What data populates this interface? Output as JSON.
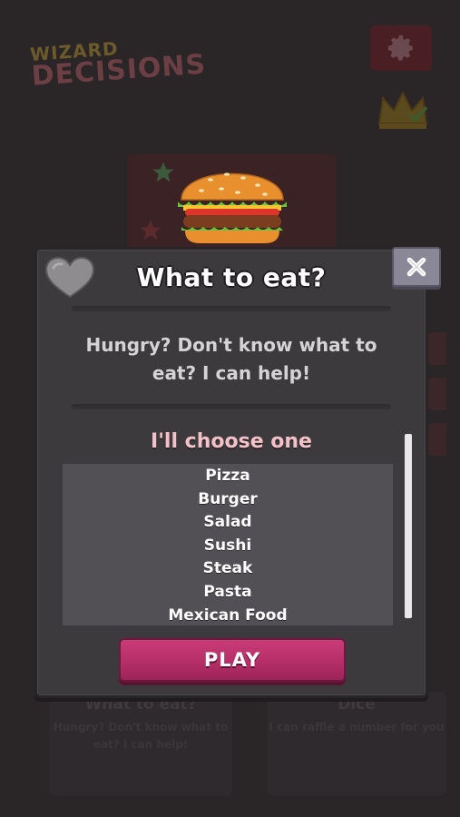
{
  "background": {
    "logo_line1": "WIZARD",
    "logo_line2": "DECISIONS",
    "card_left": {
      "title": "What to eat?",
      "description": "Hungry? Don't know what to eat? I can help!"
    },
    "card_right": {
      "title": "Dice",
      "description": "I can raffle a number for you"
    }
  },
  "icons": {
    "settings": "gear-icon",
    "crown": "crown-icon",
    "favorite": "heart-icon",
    "close": "close-icon",
    "burger": "burger-icon"
  },
  "dialog": {
    "title": "What to eat?",
    "subtitle": "Hungry? Don't know what to eat? I can help!",
    "list_heading": "I'll choose one",
    "options": [
      "Pizza",
      "Burger",
      "Salad",
      "Sushi",
      "Steak",
      "Pasta",
      "Mexican Food"
    ],
    "play_label": "PLAY"
  },
  "colors": {
    "overlay_bg": "#2a2527",
    "dialog_bg": "#3c3a3c",
    "heading_pink": "#f4c1c8",
    "play_button": "#b52e68",
    "close_button": "#8a8897",
    "list_bg": "#535055"
  }
}
